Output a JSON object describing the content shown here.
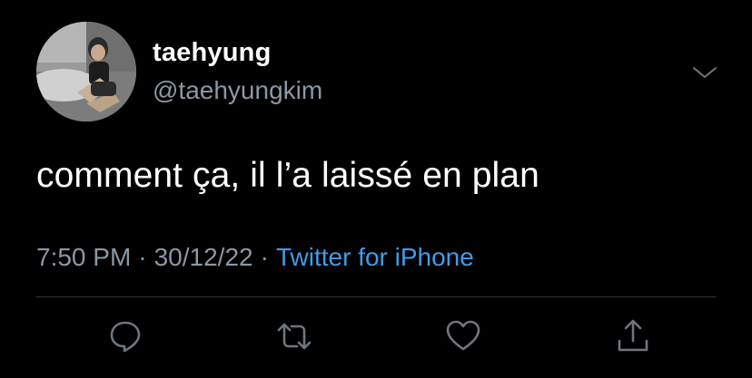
{
  "user": {
    "display_name": "taehyung",
    "handle": "@taehyungkim"
  },
  "tweet": {
    "text": "comment ça, il l’a laissé en plan"
  },
  "meta": {
    "time": "7:50 PM",
    "separator": "·",
    "date": "30/12/22",
    "source": "Twitter for iPhone"
  },
  "icons": {
    "menu": "chevron-down-icon",
    "reply": "comment-bubble-icon",
    "retweet": "retweet-icon",
    "like": "heart-icon",
    "share": "share-upload-icon"
  },
  "colors": {
    "background": "#000000",
    "primary_text": "#ffffff",
    "secondary_text": "#8b98a5",
    "link": "#3f9de9",
    "divider": "#2f3336"
  }
}
